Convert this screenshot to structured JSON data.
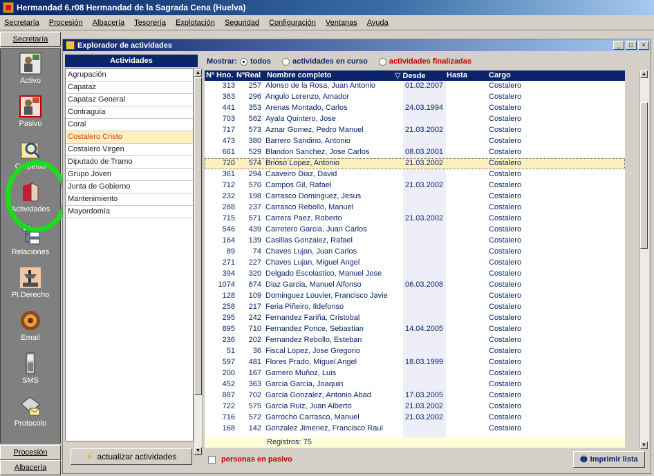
{
  "app": {
    "title": "Hermandad 6.r08  Hermandad de la Sagrada Cena (Huelva)"
  },
  "menu": [
    "Secretaría",
    "Procesión",
    "Albacería",
    "Tesorería",
    "Explotación",
    "Seguridad",
    "Configuración",
    "Ventanas",
    "Ayuda"
  ],
  "sidebar": {
    "top_header": "Secretaría",
    "items": [
      {
        "label": "Activo",
        "icon": "active-members-icon"
      },
      {
        "label": "Pasivo",
        "icon": "passive-members-icon"
      },
      {
        "label": "Carpetas",
        "icon": "folders-icon"
      },
      {
        "label": "Actividades",
        "icon": "activities-book-icon"
      },
      {
        "label": "Relaciones",
        "icon": "relations-icon"
      },
      {
        "label": "Pl.Derecho",
        "icon": "estate-icon"
      },
      {
        "label": "Email",
        "icon": "email-icon"
      },
      {
        "label": "SMS",
        "icon": "mobile-phone-icon"
      },
      {
        "label": "Protocolo",
        "icon": "protocol-icon"
      }
    ],
    "bottom_headers": [
      "Procesión",
      "Albacería"
    ]
  },
  "window": {
    "title": "Explorador de actividades"
  },
  "activities": {
    "header": "Actividades",
    "items": [
      "Agrupación",
      "Capataz",
      "Capataz General",
      "Contraguía",
      "Coral",
      "Costalero Cristo",
      "Costalero Virgen",
      "Diputado de Tramo",
      "Grupo Joven",
      "Junta de Gobierno",
      "Mantenimiento",
      "Mayordomía"
    ],
    "selected": "Costalero Cristo",
    "refresh_label": "actualizar actividades"
  },
  "filter": {
    "label": "Mostrar:",
    "options": [
      "todos",
      "actividades en curso",
      "actividades finalizadas"
    ],
    "selected": "todos"
  },
  "table": {
    "columns": [
      "Nº Hno.",
      "NºReal",
      "Nombre completo",
      "▽ Desde",
      "Hasta",
      "Cargo"
    ],
    "rows": [
      {
        "hno": "313",
        "real": "257",
        "name": "Alonso de la Rosa, Juan Antonio",
        "desde": "01.02.2007",
        "hasta": "",
        "cargo": "Costalero"
      },
      {
        "hno": "363",
        "real": "296",
        "name": "Angulo Lorenzo, Amador",
        "desde": "",
        "hasta": "",
        "cargo": "Costalero"
      },
      {
        "hno": "441",
        "real": "353",
        "name": "Arenas Montado, Carlos",
        "desde": "24.03.1994",
        "hasta": "",
        "cargo": "Costalero"
      },
      {
        "hno": "703",
        "real": "562",
        "name": "Ayala Quintero, Jose",
        "desde": "",
        "hasta": "",
        "cargo": "Costalero"
      },
      {
        "hno": "717",
        "real": "573",
        "name": "Aznar Gomez, Pedro Manuel",
        "desde": "21.03.2002",
        "hasta": "",
        "cargo": "Costalero"
      },
      {
        "hno": "473",
        "real": "380",
        "name": "Barrero Sandino, Antonio",
        "desde": "",
        "hasta": "",
        "cargo": "Costalero"
      },
      {
        "hno": "661",
        "real": "529",
        "name": "Blandon Sanchez, Jose Carlos",
        "desde": "08.03.2001",
        "hasta": "",
        "cargo": "Costalero"
      },
      {
        "hno": "720",
        "real": "574",
        "name": "Brioso Lopez, Antonio",
        "desde": "21.03.2002",
        "hasta": "",
        "cargo": "Costalero",
        "selected": true
      },
      {
        "hno": "361",
        "real": "294",
        "name": "Caaveiro Diaz, David",
        "desde": "",
        "hasta": "",
        "cargo": "Costalero"
      },
      {
        "hno": "712",
        "real": "570",
        "name": "Campos Gil, Rafael",
        "desde": "21.03.2002",
        "hasta": "",
        "cargo": "Costalero"
      },
      {
        "hno": "232",
        "real": "198",
        "name": "Carrasco Dominguez, Jesus",
        "desde": "",
        "hasta": "",
        "cargo": "Costalero"
      },
      {
        "hno": "288",
        "real": "237",
        "name": "Carrasco Rebollo, Manuel",
        "desde": "",
        "hasta": "",
        "cargo": "Costalero"
      },
      {
        "hno": "715",
        "real": "571",
        "name": "Carrera Paez, Roberto",
        "desde": "21.03.2002",
        "hasta": "",
        "cargo": "Costalero"
      },
      {
        "hno": "546",
        "real": "439",
        "name": "Carretero Garcia, Juan Carlos",
        "desde": "",
        "hasta": "",
        "cargo": "Costalero"
      },
      {
        "hno": "164",
        "real": "139",
        "name": "Casillas Gonzalez, Rafael",
        "desde": "",
        "hasta": "",
        "cargo": "Costalero"
      },
      {
        "hno": "89",
        "real": "74",
        "name": "Chaves Lujan, Juan Carlos",
        "desde": "",
        "hasta": "",
        "cargo": "Costalero"
      },
      {
        "hno": "271",
        "real": "227",
        "name": "Chaves Lujan, Miguel Angel",
        "desde": "",
        "hasta": "",
        "cargo": "Costalero"
      },
      {
        "hno": "394",
        "real": "320",
        "name": "Delgado Escolastico, Manuel Jose",
        "desde": "",
        "hasta": "",
        "cargo": "Costalero"
      },
      {
        "hno": "1074",
        "real": "874",
        "name": "Diaz Garcia, Manuel Alfonso",
        "desde": "06.03.2008",
        "hasta": "",
        "cargo": "Costalero"
      },
      {
        "hno": "128",
        "real": "109",
        "name": "Dominguez Louvier, Francisco Javie",
        "desde": "",
        "hasta": "",
        "cargo": "Costalero"
      },
      {
        "hno": "258",
        "real": "217",
        "name": "Feria Piñeiro, Ildefonso",
        "desde": "",
        "hasta": "",
        "cargo": "Costalero"
      },
      {
        "hno": "295",
        "real": "242",
        "name": "Fernandez Fariña, Cristobal",
        "desde": "",
        "hasta": "",
        "cargo": "Costalero"
      },
      {
        "hno": "895",
        "real": "710",
        "name": "Fernandez Ponce, Sebastian",
        "desde": "14.04.2005",
        "hasta": "",
        "cargo": "Costalero"
      },
      {
        "hno": "236",
        "real": "202",
        "name": "Fernandez Rebollo, Esteban",
        "desde": "",
        "hasta": "",
        "cargo": "Costalero"
      },
      {
        "hno": "51",
        "real": "36",
        "name": "Fiscal Lopez, Jose Gregorio",
        "desde": "",
        "hasta": "",
        "cargo": "Costalero"
      },
      {
        "hno": "597",
        "real": "481",
        "name": "Flores Prado, Miguel Angel",
        "desde": "18.03.1999",
        "hasta": "",
        "cargo": "Costalero"
      },
      {
        "hno": "200",
        "real": "167",
        "name": "Gamero Muñoz, Luis",
        "desde": "",
        "hasta": "",
        "cargo": "Costalero"
      },
      {
        "hno": "452",
        "real": "363",
        "name": "Garcia Garcia, Joaquin",
        "desde": "",
        "hasta": "",
        "cargo": "Costalero"
      },
      {
        "hno": "887",
        "real": "702",
        "name": "Garcia Gonzalez, Antonio Abad",
        "desde": "17.03.2005",
        "hasta": "",
        "cargo": "Costalero"
      },
      {
        "hno": "722",
        "real": "575",
        "name": "Garcia Ruiz, Juan Alberto",
        "desde": "21.03.2002",
        "hasta": "",
        "cargo": "Costalero"
      },
      {
        "hno": "716",
        "real": "572",
        "name": "Garrocho Carrasco, Manuel",
        "desde": "21.03.2002",
        "hasta": "",
        "cargo": "Costalero"
      },
      {
        "hno": "168",
        "real": "142",
        "name": "Gonzalez Jimenez, Francisco Raul",
        "desde": "",
        "hasta": "",
        "cargo": "Costalero"
      }
    ],
    "footer": "Registros: 75"
  },
  "bottom": {
    "pasivo_label": "personas en pasivo",
    "print_label": "Imprimir lista"
  },
  "colors": {
    "titlebar": "#0a246a",
    "selection": "#fff0c0",
    "highlight_ring": "#18e018",
    "alert_text": "#c00000"
  }
}
